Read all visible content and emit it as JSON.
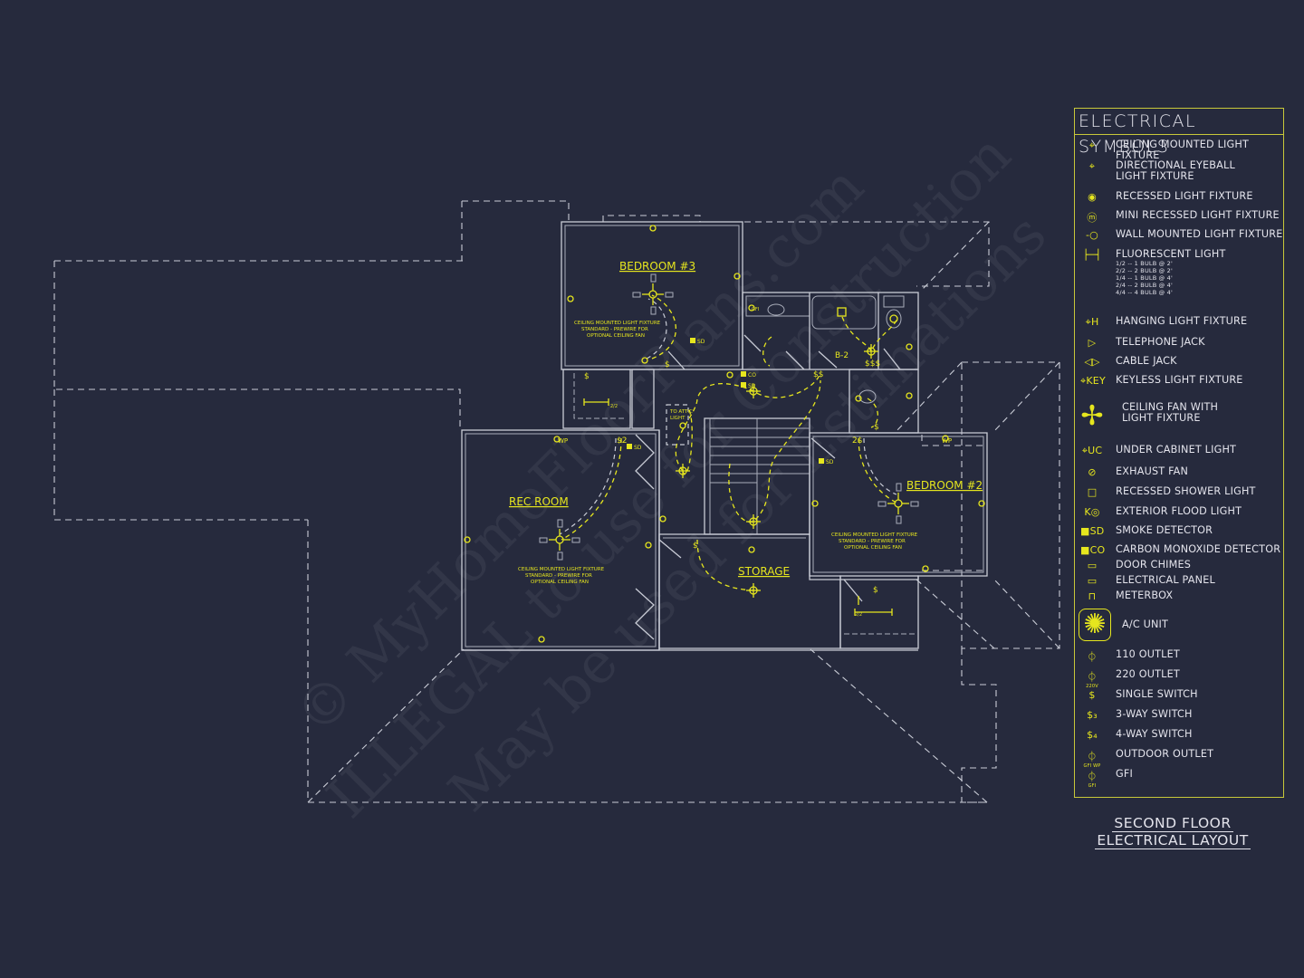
{
  "drawing": {
    "title_line1": "SECOND FLOOR",
    "title_line2": "ELECTRICAL LAYOUT",
    "colors": {
      "background": "#262a3d",
      "walls": "#c9ccd6",
      "electrical": "#e6e61e",
      "legend_border": "#c8c83a"
    }
  },
  "rooms": {
    "bedroom3": "BEDROOM #3",
    "bedroom2": "BEDROOM #2",
    "rec_room": "REC ROOM",
    "storage": "STORAGE",
    "bath": "B-2"
  },
  "notes": {
    "fan_note_l1": "CEILING MOUNTED LIGHT FIXTURE",
    "fan_note_l2": "STANDARD - PREWIRE FOR",
    "fan_note_l3": "OPTIONAL CEILING FAN",
    "attic_l1": "TO ATTIC",
    "attic_l2": "LIGHT",
    "closet_dim": "2/2",
    "smoke": "SD",
    "co": "CO",
    "gfi": "GFI",
    "wp": "WP"
  },
  "legend": {
    "title": "ELECTRICAL SYMBOLS",
    "items": [
      {
        "icon": "ceiling-light-icon",
        "glyph": "⌖",
        "label": "CEILING MOUNTED LIGHT FIXTURE"
      },
      {
        "icon": "eyeball-light-icon",
        "glyph": "⌖",
        "label": "DIRECTIONAL EYEBALL",
        "label2": "LIGHT FIXTURE"
      },
      {
        "icon": "recessed-light-icon",
        "glyph": "◉",
        "label": "RECESSED LIGHT FIXTURE"
      },
      {
        "icon": "mini-recessed-light-icon",
        "glyph": "ⓜ",
        "label": "MINI RECESSED LIGHT FIXTURE"
      },
      {
        "icon": "wall-light-icon",
        "glyph": "-○",
        "label": "WALL MOUNTED LIGHT FIXTURE"
      },
      {
        "icon": "fluorescent-light-icon",
        "glyph": "├─┤",
        "label": "FLUORESCENT LIGHT",
        "sub": [
          "1/2 -- 1 BULB @ 2'",
          "2/2 -- 2 BULB @ 2'",
          "1/4 -- 1 BULB @ 4'",
          "2/4 -- 2 BULB @ 4'",
          "4/4 -- 4 BULB @ 4'"
        ]
      },
      {
        "icon": "hanging-light-icon",
        "glyph": "⌖H",
        "label": "HANGING LIGHT FIXTURE"
      },
      {
        "icon": "telephone-jack-icon",
        "glyph": "▷",
        "label": "TELEPHONE JACK"
      },
      {
        "icon": "cable-jack-icon",
        "glyph": "◁▷",
        "label": "CABLE JACK"
      },
      {
        "icon": "keyless-light-icon",
        "glyph": "⌖KEY",
        "label": "KEYLESS LIGHT FIXTURE"
      },
      {
        "icon": "ceiling-fan-icon",
        "glyph": "✢",
        "label": "CEILING FAN WITH",
        "label2": "LIGHT FIXTURE"
      },
      {
        "icon": "under-cabinet-light-icon",
        "glyph": "⌖UC",
        "label": "UNDER CABINET LIGHT"
      },
      {
        "icon": "exhaust-fan-icon",
        "glyph": "⊘",
        "label": "EXHAUST FAN"
      },
      {
        "icon": "recessed-shower-light-icon",
        "glyph": "□",
        "label": "RECESSED SHOWER LIGHT"
      },
      {
        "icon": "exterior-flood-light-icon",
        "glyph": "K◎",
        "label": "EXTERIOR FLOOD LIGHT"
      },
      {
        "icon": "smoke-detector-icon",
        "glyph": "■SD",
        "label": "SMOKE DETECTOR"
      },
      {
        "icon": "co-detector-icon",
        "glyph": "■CO",
        "label": "CARBON MONOXIDE DETECTOR"
      },
      {
        "icon": "door-chimes-icon",
        "glyph": "▭",
        "label": "DOOR CHIMES"
      },
      {
        "icon": "electrical-panel-icon",
        "glyph": "▭",
        "label": "ELECTRICAL PANEL"
      },
      {
        "icon": "meterbox-icon",
        "glyph": "⊓",
        "label": "METERBOX"
      },
      {
        "icon": "ac-unit-icon",
        "glyph": "✺",
        "label": "A/C UNIT"
      },
      {
        "icon": "outlet-110-icon",
        "glyph": "⏀",
        "label": "110 OUTLET"
      },
      {
        "icon": "outlet-220-icon",
        "glyph": "⏀",
        "sub_glyph": "220V",
        "label": "220 OUTLET"
      },
      {
        "icon": "single-switch-icon",
        "glyph": "$",
        "label": "SINGLE SWITCH"
      },
      {
        "icon": "three-way-switch-icon",
        "glyph": "$₃",
        "label": "3-WAY SWITCH"
      },
      {
        "icon": "four-way-switch-icon",
        "glyph": "$₄",
        "label": "4-WAY SWITCH"
      },
      {
        "icon": "outdoor-outlet-icon",
        "glyph": "⏀",
        "sub_glyph": "GFI WP",
        "label": "OUTDOOR OUTLET"
      },
      {
        "icon": "gfi-outlet-icon",
        "glyph": "⏀",
        "sub_glyph": "GFI",
        "label": "GFI"
      }
    ]
  },
  "watermark": {
    "line1": "© MyHomeFloorPlans.com",
    "line2": "ILLEGAL to use for Construction",
    "line3": "May be used for Estimations"
  }
}
